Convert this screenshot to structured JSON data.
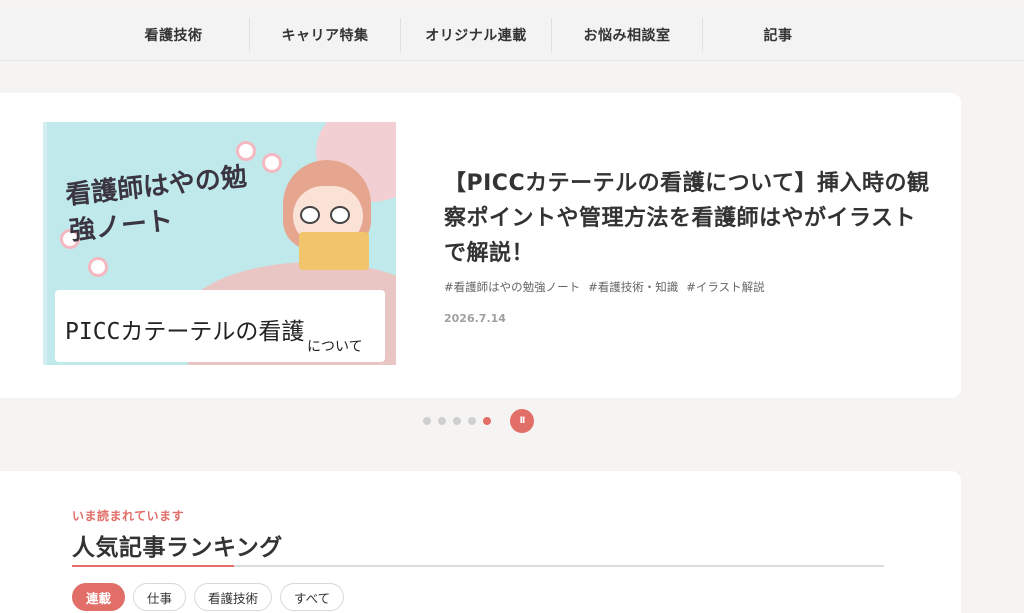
{
  "nav": {
    "items": [
      {
        "label": "看護技術"
      },
      {
        "label": "キャリア特集"
      },
      {
        "label": "オリジナル連載"
      },
      {
        "label": "お悩み相談室"
      },
      {
        "label": "記事"
      }
    ]
  },
  "hero": {
    "thumbnail": {
      "handwritten_title": "看護師はやの勉強ノート",
      "label_main": "PICCカテーテルの看護",
      "label_sub": "について"
    },
    "title": "【PICCカテーテルの看護について】挿入時の観察ポイントや管理方法を看護師はやがイラストで解説！",
    "tags": [
      "#看護師はやの勉強ノート",
      "#看護技術・知識",
      "#イラスト解説"
    ],
    "date": "2026.7.14"
  },
  "slider": {
    "dot_count": 5,
    "active_index": 4,
    "pause_icon": "pause-icon",
    "pause_glyph": "II"
  },
  "ranking": {
    "subtitle": "いま読まれています",
    "title": "人気記事ランキング",
    "filters": [
      {
        "label": "連載",
        "active": true
      },
      {
        "label": "仕事",
        "active": false
      },
      {
        "label": "看護技術",
        "active": false
      },
      {
        "label": "すべて",
        "active": false
      }
    ]
  },
  "colors": {
    "accent": "#e26e68",
    "background": "#f5f4f3",
    "card": "#ffffff",
    "thumb_bg": "#bfe9ea"
  }
}
